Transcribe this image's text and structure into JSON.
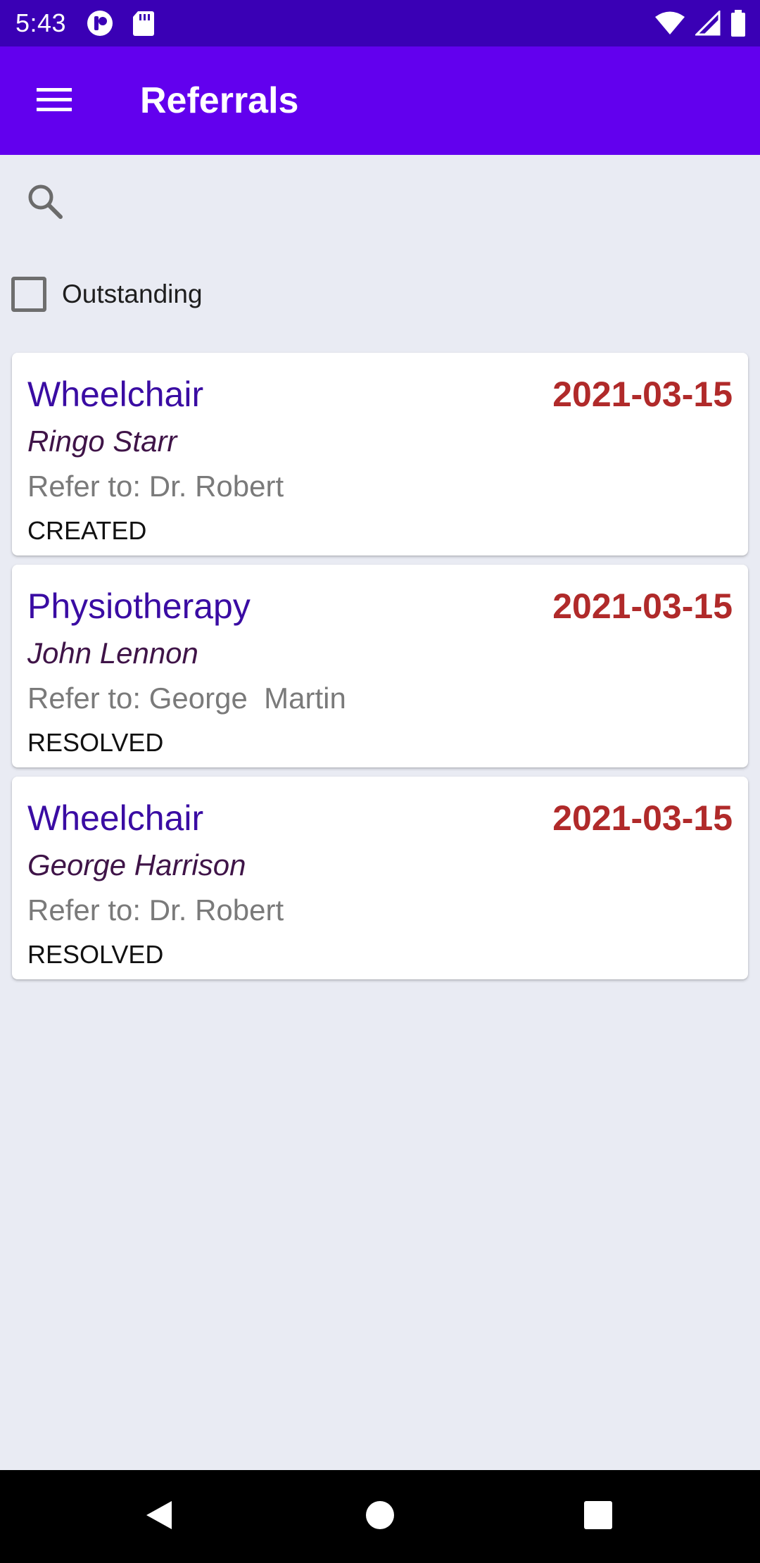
{
  "status_bar": {
    "time": "5:43",
    "left_icons": [
      "app-notification-icon",
      "sd-card-icon"
    ],
    "right_icons": [
      "wifi-icon",
      "cell-signal-icon",
      "battery-icon"
    ]
  },
  "app_bar": {
    "title": "Referrals",
    "menu_icon": "menu-icon"
  },
  "search": {
    "icon": "search-icon",
    "value": ""
  },
  "filter": {
    "label": "Outstanding",
    "checked": false
  },
  "referrals": [
    {
      "type": "Wheelchair",
      "date": "2021-03-15",
      "client": "Ringo Starr",
      "refer_to": "Refer to: Dr. Robert",
      "status": "CREATED"
    },
    {
      "type": "Physiotherapy",
      "date": "2021-03-15",
      "client": "John Lennon",
      "refer_to": "Refer to: George  Martin",
      "status": "RESOLVED"
    },
    {
      "type": "Wheelchair",
      "date": "2021-03-15",
      "client": "George Harrison",
      "refer_to": "Refer to: Dr. Robert",
      "status": "RESOLVED"
    }
  ],
  "nav_bar": {
    "buttons": [
      "back-icon",
      "home-icon",
      "recents-icon"
    ]
  },
  "colors": {
    "status_bar": "#3A00B5",
    "app_bar": "#6200EE",
    "background": "#E9EBF3",
    "type_text": "#3A0CA3",
    "date_text": "#B02A2A",
    "client_text": "#3F1448",
    "refer_text": "#7A7A7A"
  }
}
